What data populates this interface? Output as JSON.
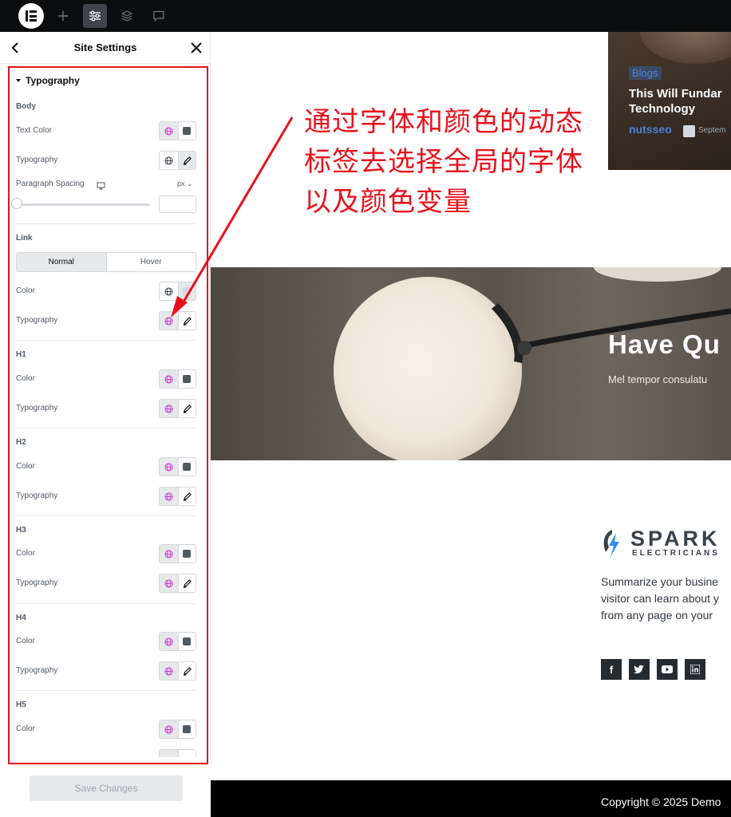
{
  "topbar": {
    "logo": "elementor-logo",
    "tools": [
      "add-icon",
      "site-settings-icon",
      "layers-icon",
      "comments-icon"
    ]
  },
  "panel": {
    "title": "Site Settings",
    "section": "Typography",
    "body": {
      "heading": "Body",
      "text_color": "Text Color",
      "typography": "Typography",
      "paragraph_spacing": "Paragraph Spacing",
      "unit": "px"
    },
    "link": {
      "heading": "Link",
      "tabs": [
        "Normal",
        "Hover"
      ],
      "color": "Color",
      "typography": "Typography"
    },
    "headings": [
      {
        "heading": "H1",
        "color": "Color",
        "typography": "Typography"
      },
      {
        "heading": "H2",
        "color": "Color",
        "typography": "Typography"
      },
      {
        "heading": "H3",
        "color": "Color",
        "typography": "Typography"
      },
      {
        "heading": "H4",
        "color": "Color",
        "typography": "Typography"
      },
      {
        "heading": "H5",
        "color": "Color"
      }
    ],
    "save": "Save Changes"
  },
  "annotation": [
    "通过字体和颜色的动态",
    "标签去选择全局的字体",
    "以及颜色变量"
  ],
  "preview": {
    "blog": {
      "tag": "Blogs",
      "title": "This Will Fundar Technology",
      "author": "nutsseo",
      "date": "Septem"
    },
    "hero": {
      "headline": "Have Qu",
      "sub": "Mel tempor consulatu"
    },
    "brand": {
      "name": "SPARK",
      "sub": "ELECTRICIANS"
    },
    "summary": [
      "Summarize your busine",
      "visitor can learn about y",
      "from any page on your"
    ],
    "social": [
      "f",
      "t",
      "▶",
      "in"
    ],
    "footer": "Copyright © 2025 Demo"
  },
  "colors": {
    "accent_red": "#e8121c",
    "global_pink": "#c935d6",
    "link_blue": "#4d7fd6"
  }
}
